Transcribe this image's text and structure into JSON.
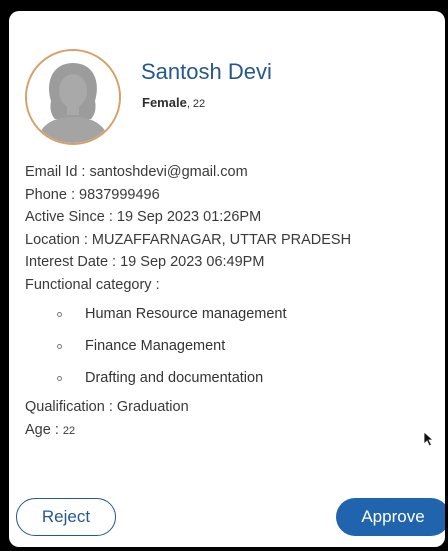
{
  "profile": {
    "name": "Santosh Devi",
    "gender": "Female",
    "age_inline": ", 22"
  },
  "details": {
    "email_label": "Email Id : ",
    "email_value": "santoshdevi@gmail.com",
    "phone_label": "Phone : ",
    "phone_value": "9837999496",
    "active_label": "Active Since : ",
    "active_value": "19 Sep 2023 01:26PM",
    "location_label": "Location : ",
    "location_value": "MUZAFFARNAGAR, UTTAR PRADESH",
    "interest_label": "Interest Date : ",
    "interest_value": "19 Sep 2023 06:49PM",
    "category_label": "Functional category :",
    "categories": [
      "Human Resource management",
      "Finance Management",
      "Drafting and documentation"
    ],
    "qualification_label": "Qualification : ",
    "qualification_value": "Graduation",
    "age_label": "Age : ",
    "age_value": "22"
  },
  "actions": {
    "reject_label": "Reject",
    "approve_label": "Approve"
  },
  "colors": {
    "name": "#25588f",
    "approve_bg": "#1f64ad",
    "avatar_ring": "#d8a066"
  },
  "icons": {
    "avatar": "female-avatar-placeholder",
    "cursor": "mouse-pointer-icon"
  }
}
